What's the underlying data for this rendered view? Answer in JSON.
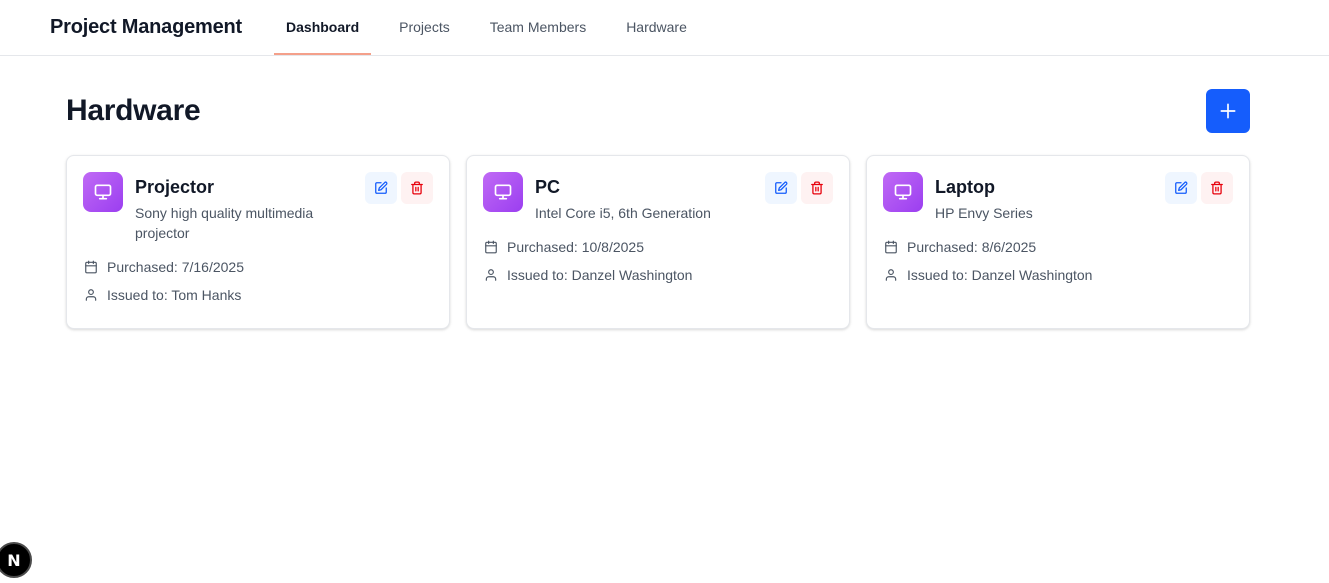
{
  "app": {
    "title": "Project Management"
  },
  "nav": {
    "items": [
      {
        "label": "Dashboard",
        "active": true
      },
      {
        "label": "Projects",
        "active": false
      },
      {
        "label": "Team Members",
        "active": false
      },
      {
        "label": "Hardware",
        "active": false
      }
    ]
  },
  "page": {
    "title": "Hardware"
  },
  "hardware": [
    {
      "name": "Projector",
      "description": "Sony high quality multimedia projector",
      "purchased": "Purchased: 7/16/2025",
      "issued_to": "Issued to: Tom Hanks"
    },
    {
      "name": "PC",
      "description": "Intel Core i5, 6th Generation",
      "purchased": "Purchased: 10/8/2025",
      "issued_to": "Issued to: Danzel Washington"
    },
    {
      "name": "Laptop",
      "description": "HP Envy Series",
      "purchased": "Purchased: 8/6/2025",
      "issued_to": "Issued to: Danzel Washington"
    }
  ],
  "icons": {
    "add": "plus-icon",
    "hardware": "monitor-icon",
    "edit": "edit-icon",
    "delete": "trash-icon",
    "purchased": "calendar-icon",
    "issued": "user-icon",
    "badge": "nextjs-logo"
  },
  "badge": {
    "letter": "N"
  },
  "colors": {
    "primary": "#155dfc",
    "accent_underline": "#f4a08a",
    "icon_gradient_start": "#c06af5",
    "icon_gradient_end": "#9b3ef0",
    "edit": "#155dfc",
    "delete": "#e7000b"
  }
}
